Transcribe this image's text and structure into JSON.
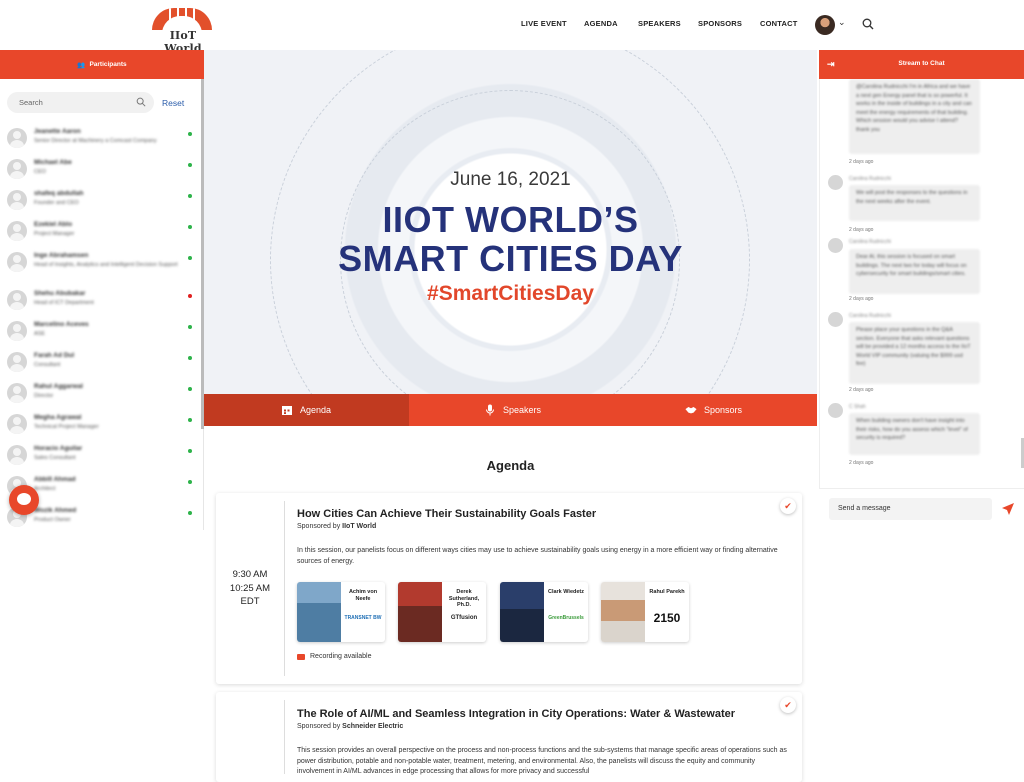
{
  "brand": {
    "logo_text": "IIoT World"
  },
  "nav": {
    "items": [
      "LIVE EVENT",
      "AGENDA",
      "SPEAKERS",
      "SPONSORS",
      "CONTACT"
    ]
  },
  "colors": {
    "accent": "#e8472a",
    "navy": "#25327a"
  },
  "participants": {
    "header": "Participants",
    "search_placeholder": "Search",
    "reset": "Reset",
    "items": [
      {
        "name": "Jeanette Aaron",
        "title": "Senior Director at Machinery a Comcast Company",
        "status": "online"
      },
      {
        "name": "Michael Abe",
        "title": "CEO",
        "status": "online"
      },
      {
        "name": "shafeq abdullah",
        "title": "Founder and CEO",
        "status": "online"
      },
      {
        "name": "Ezekiel Ablo",
        "title": "Project Manager",
        "status": "online"
      },
      {
        "name": "Inge Abrahamsen",
        "title": "Head of Insights, Analytics and Intelligent Decision Support",
        "status": "online"
      },
      {
        "name": "Shehu Abubakar",
        "title": "Head of ICT Department",
        "status": "busy"
      },
      {
        "name": "Marcelino Aceves",
        "title": "ASE",
        "status": "online"
      },
      {
        "name": "Farah Ad Dul",
        "title": "Consultant",
        "status": "online"
      },
      {
        "name": "Rahul Aggarwal",
        "title": "Director",
        "status": "online"
      },
      {
        "name": "Megha Agrawal",
        "title": "Technical Project Manager",
        "status": "online"
      },
      {
        "name": "Horacio Aguilar",
        "title": "Sales Consultant",
        "status": "online"
      },
      {
        "name": "Abbill Ahmad",
        "title": "Architect",
        "status": "online"
      },
      {
        "name": "Wozik Ahmed",
        "title": "Product Owner",
        "status": "online"
      }
    ]
  },
  "hero": {
    "date": "June 16, 2021",
    "title_line1": "IIOT WORLD’S",
    "title_line2": "SMART CITIES DAY",
    "hashtag": "#SmartCitiesDay"
  },
  "tabs": [
    {
      "label": "Agenda"
    },
    {
      "label": "Speakers"
    },
    {
      "label": "Sponsors"
    }
  ],
  "agenda": {
    "heading": "Agenda",
    "sessions": [
      {
        "time1": "9:30 AM",
        "time2": "10:25 AM",
        "time3": "EDT",
        "title": "How Cities Can Achieve Their Sustainability Goals Faster",
        "sponsored_prefix": "Sponsored by",
        "sponsor": "IIoT World",
        "description": "In this session, our panelists focus on different ways cities may use to achieve sustainability goals using energy in a more efficient way or finding alternative sources of energy.",
        "speakers": [
          {
            "name": "Achim von Neefe",
            "company": "TRANSNET BW"
          },
          {
            "name": "Derek Sutherland, Ph.D.",
            "company": "GTfusion"
          },
          {
            "name": "Clark Wiedetz",
            "company": "GreenBrussels"
          },
          {
            "name": "Rahul Parekh",
            "company": "2150"
          }
        ],
        "recording": "Recording available"
      },
      {
        "title": "The Role of AI/ML and Seamless Integration in City Operations: Water & Wastewater",
        "sponsored_prefix": "Sponsored by",
        "sponsor": "Schneider Electric",
        "description": "This session provides an overall perspective on the process and non-process functions and the sub-systems that manage specific areas of operations such as power distribution, potable and non-potable water, treatment, metering, and environmental. Also, the panelists will discuss the equity and community involvement in AI/ML advances in edge processing that allows for more privacy and successful"
      }
    ]
  },
  "chat": {
    "header": "Stream to Chat",
    "messages": [
      {
        "name": "",
        "text": "@Carolina Rudnicchi I'm in Africa and we have a next gen Energy panel that is so powerful. It works in the inside of buildings in a city and can meet the energy requirements of that building. Which session would you advise I attend? thank you",
        "time": "2 days ago"
      },
      {
        "name": "Carolina Rudnicchi",
        "text": "We will post the responses to the questions in the next weeks after the event.",
        "time": "2 days ago"
      },
      {
        "name": "Carolina Rudnicchi",
        "text": "Dear Al, this session is focused on smart buildings. The next two for today will focus on cybersecurity for smart buildings/smart cities.",
        "time": "2 days ago"
      },
      {
        "name": "Carolina Rudnicchi",
        "text": "Please place your questions in the Q&A section. Everyone that asks relevant questions will be provided a 12 months access to the IIoT World VIP community (valuing the $999 usd fee)",
        "time": "2 days ago"
      },
      {
        "name": "C Shah",
        "text": "When building owners don't have insight into their risks, how do you assess which \"level\" of security is required?",
        "time": "2 days ago"
      }
    ],
    "input_placeholder": "Send a message"
  }
}
